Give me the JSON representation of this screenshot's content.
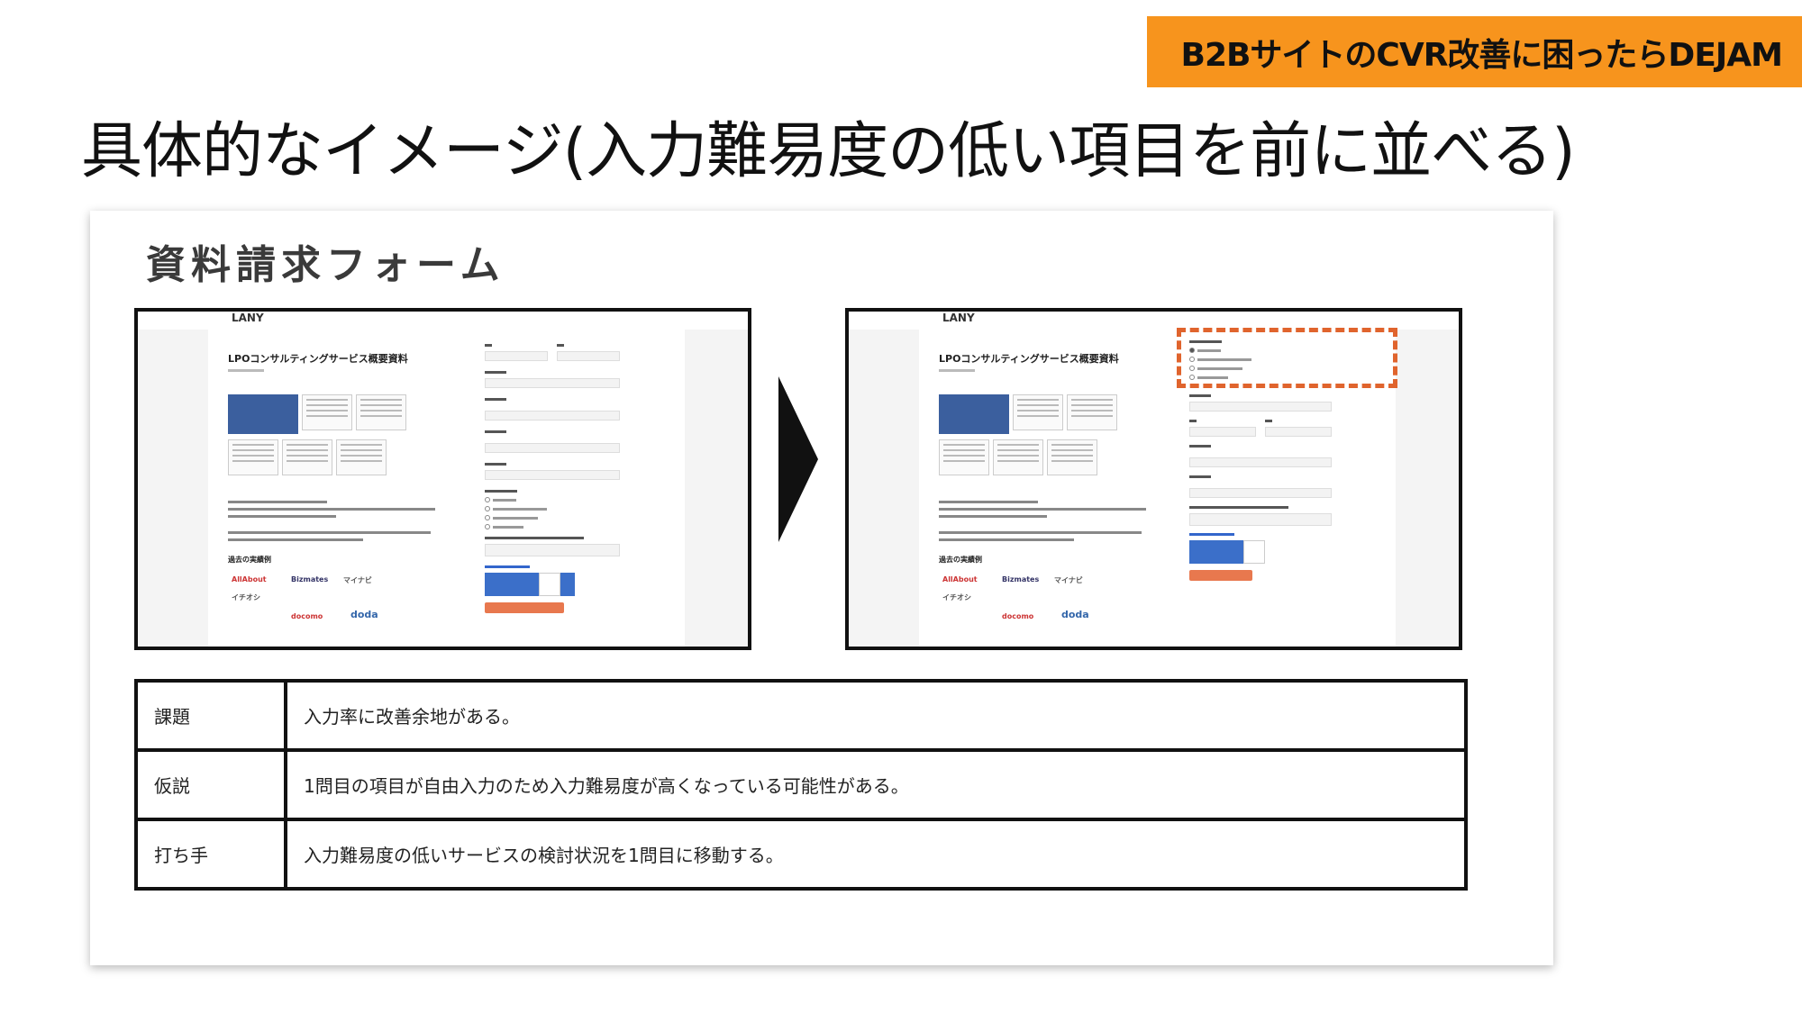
{
  "banner": {
    "text": "B2BサイトのCVR改善に困ったらDEJAM"
  },
  "slide": {
    "title": "具体的なイメージ(入力難易度の低い項目を前に並べる)"
  },
  "card": {
    "title": "資料請求フォーム"
  },
  "screenshot": {
    "logo": "LANY",
    "doc_title": "LPOコンサルティングサービス概要資料",
    "section_heading": "過去の実績例",
    "brands": [
      "AllAbout",
      "Bizmates",
      "マイナビ",
      "イチオシ",
      "docomo",
      "doda"
    ]
  },
  "table": {
    "rows": [
      {
        "key": "課題",
        "value": "入力率に改善余地がある。"
      },
      {
        "key": "仮説",
        "value": "1問目の項目が自由入力のため入力難易度が高くなっている可能性がある。"
      },
      {
        "key": "打ち手",
        "value": "入力難易度の低いサービスの検討状況を1問目に移動する。"
      }
    ]
  },
  "colors": {
    "banner": "#f7941d",
    "highlight": "#e0642d",
    "button": "#e8784e",
    "doc_blue": "#3b5f9e"
  }
}
